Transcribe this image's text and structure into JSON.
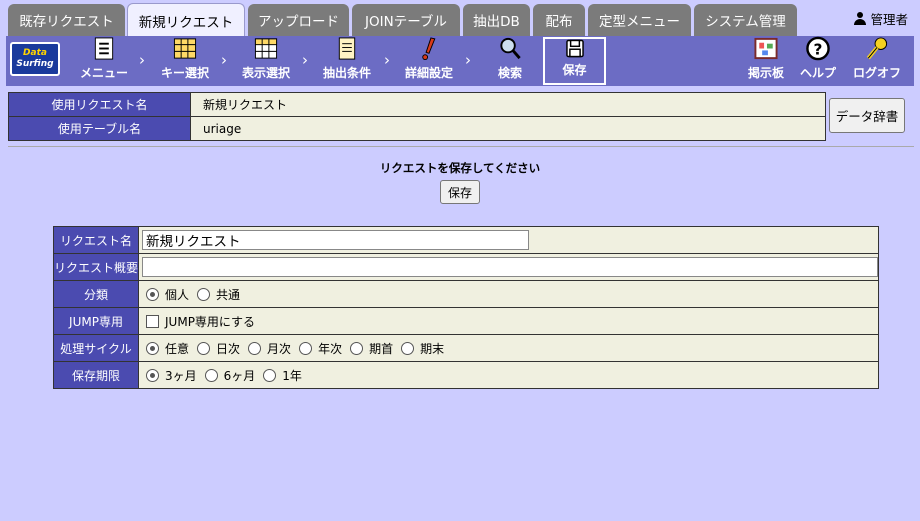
{
  "tabs": [
    "既存リクエスト",
    "新規リクエスト",
    "アップロード",
    "JOINテーブル",
    "抽出DB",
    "配布",
    "定型メニュー",
    "システム管理"
  ],
  "user": {
    "name": "管理者"
  },
  "logo": {
    "line1": "Data",
    "line2": "Surfing"
  },
  "toolbar": {
    "menu": "メニュー",
    "key_select": "キー選択",
    "display_select": "表示選択",
    "extract_condition": "抽出条件",
    "detail_settings": "詳細設定",
    "search": "検索",
    "save": "保存",
    "board": "掲示板",
    "help": "ヘルプ",
    "logoff": "ログオフ"
  },
  "info": {
    "request_label": "使用リクエスト名",
    "request_value": "新規リクエスト",
    "table_label": "使用テーブル名",
    "table_value": "uriage",
    "dict_button": "データ辞書"
  },
  "message": "リクエストを保存してください",
  "save_button": "保存",
  "form": {
    "name_label": "リクエスト名",
    "name_value": "新規リクエスト",
    "summary_label": "リクエスト概要",
    "summary_value": "",
    "category_label": "分類",
    "category_options": [
      "個人",
      "共通"
    ],
    "category_selected": "個人",
    "jump_label": "JUMP専用",
    "jump_checkbox": "JUMP専用にする",
    "jump_checked": false,
    "cycle_label": "処理サイクル",
    "cycle_options": [
      "任意",
      "日次",
      "月次",
      "年次",
      "期首",
      "期末"
    ],
    "cycle_selected": "任意",
    "retention_label": "保存期限",
    "retention_options": [
      "3ヶ月",
      "6ヶ月",
      "1年"
    ],
    "retention_selected": "3ヶ月"
  },
  "colors": {
    "background": "#ccccff",
    "toolbar": "#6c6cc4",
    "label_cell": "#4b4bb0",
    "value_cell": "#f0f0e0"
  }
}
